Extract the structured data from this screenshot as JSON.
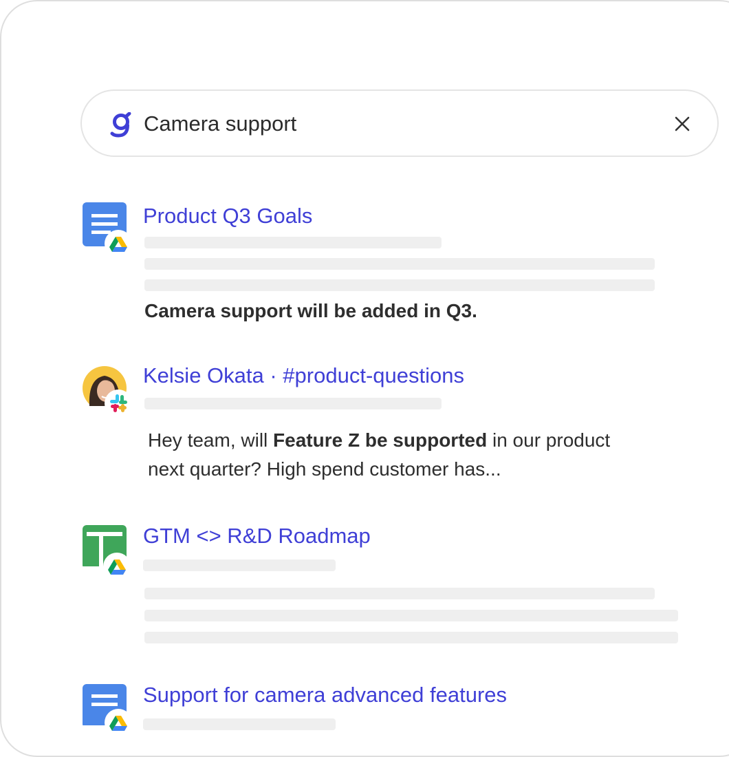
{
  "search": {
    "query": "Camera support",
    "clear_icon": "close-icon",
    "logo_icon": "glean-g-icon"
  },
  "colors": {
    "accent": "#3f3fd6",
    "docs_blue": "#4a86e8",
    "sheets_green": "#3fa65a",
    "skeleton": "#efefef"
  },
  "results": [
    {
      "title": "Product Q3 Goals",
      "icon": "google-docs-icon",
      "source_icon": "google-drive-icon",
      "snippet_bold": "Camera support will be added in Q3."
    },
    {
      "title": "Kelsie Okata · #product-questions",
      "icon": "avatar",
      "source_icon": "slack-icon",
      "snippet_pre": "Hey team, will ",
      "snippet_bold": "Feature Z be supported",
      "snippet_post_line1": " in our product",
      "snippet_line2": "next quarter? High spend customer has..."
    },
    {
      "title": "GTM <> R&D Roadmap",
      "icon": "google-sheets-icon",
      "source_icon": "google-drive-icon"
    },
    {
      "title": "Support for camera advanced features",
      "icon": "google-docs-icon",
      "source_icon": "google-drive-icon"
    }
  ]
}
